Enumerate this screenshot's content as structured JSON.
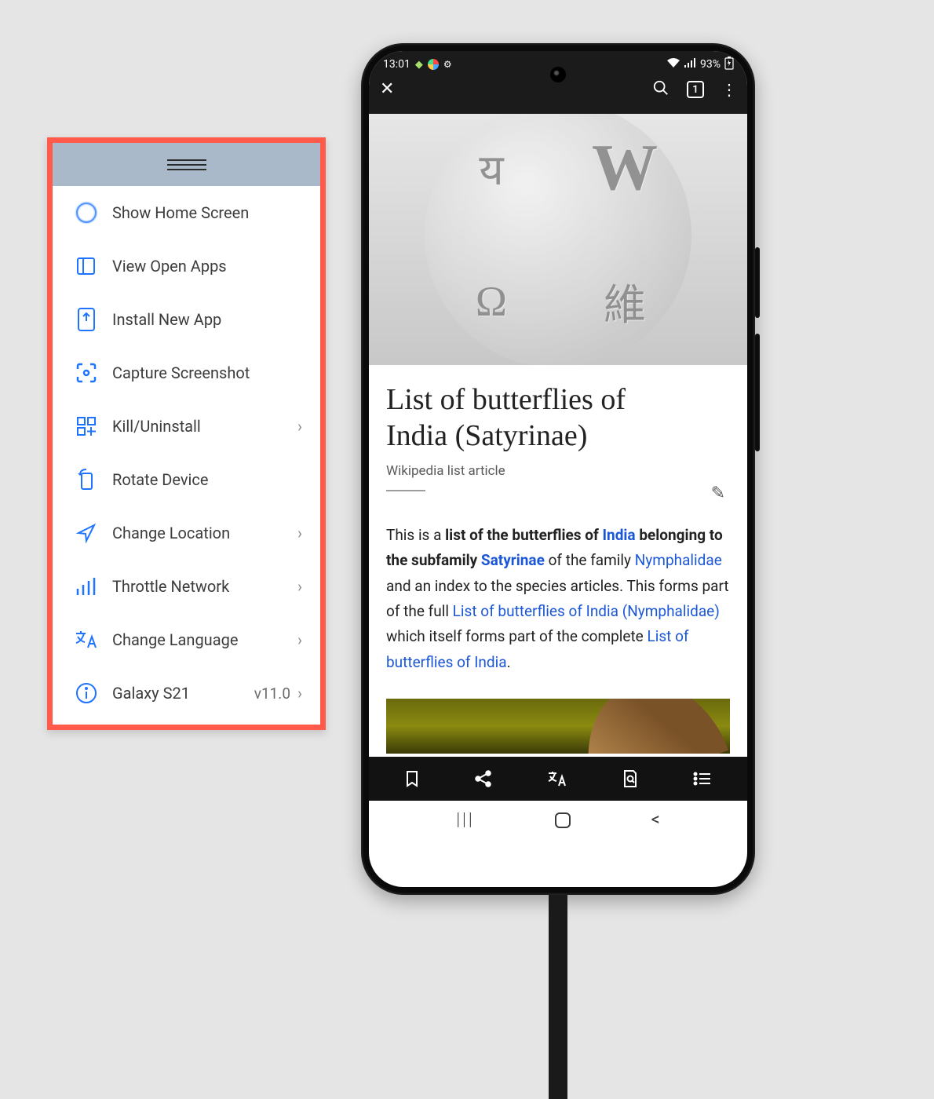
{
  "control_panel": {
    "items": [
      {
        "label": "Show Home Screen",
        "icon": "home-circle-icon",
        "chevron": false
      },
      {
        "label": "View Open Apps",
        "icon": "open-apps-icon",
        "chevron": false
      },
      {
        "label": "Install New App",
        "icon": "install-icon",
        "chevron": false
      },
      {
        "label": "Capture Screenshot",
        "icon": "capture-icon",
        "chevron": false
      },
      {
        "label": "Kill/Uninstall",
        "icon": "apps-icon",
        "chevron": true
      },
      {
        "label": "Rotate Device",
        "icon": "rotate-icon",
        "chevron": false
      },
      {
        "label": "Change Location",
        "icon": "location-icon",
        "chevron": true
      },
      {
        "label": "Throttle Network",
        "icon": "network-icon",
        "chevron": true
      },
      {
        "label": "Change Language",
        "icon": "language-icon",
        "chevron": true
      },
      {
        "label": "Galaxy S21",
        "icon": "info-icon",
        "chevron": true,
        "sub": "v11.0"
      }
    ]
  },
  "phone": {
    "status": {
      "time": "13:01",
      "battery": "93%"
    },
    "browser_bar": {
      "tab_count": "1"
    },
    "article": {
      "title_line1": "List of butterflies of",
      "title_line2": "India (Satyrinae)",
      "subtitle": "Wikipedia list article",
      "body": {
        "t1": "This is a ",
        "b1": "list of the butterflies of ",
        "l1": "India",
        "t2": " ",
        "b2": "belonging to the subfamily ",
        "l2": "Satyrinae",
        "t3": " of the family ",
        "l3": "Nymphalidae",
        "t4": " and an index to the species articles. This forms part of the full ",
        "l4": "List of butterflies of India (Nymphalidae)",
        "t5": " which itself forms part of the complete ",
        "l5": "List of butterflies of India",
        "t6": "."
      }
    },
    "globe_letters": {
      "a": "य",
      "b": "W",
      "c": "Ω",
      "d": "維"
    }
  }
}
